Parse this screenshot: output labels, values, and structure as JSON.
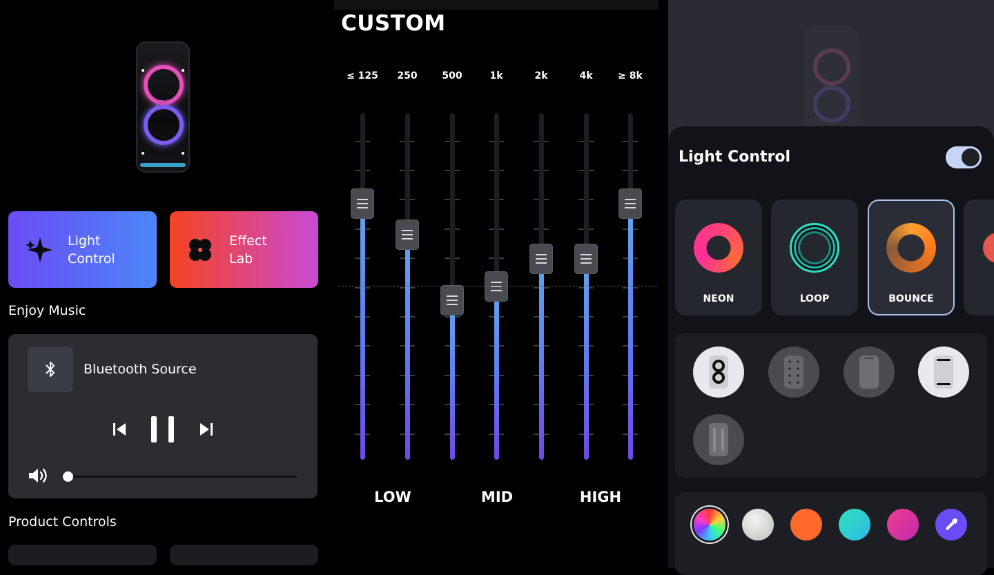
{
  "home": {
    "tiles": [
      {
        "label": "Light\nControl",
        "icon": "sparkle-icon",
        "gradient": [
          "#6a4cf5",
          "#4d86f7"
        ]
      },
      {
        "label": "Effect\nLab",
        "icon": "flower-icon",
        "gradient": [
          "#f5441f",
          "#c84ad6"
        ]
      }
    ],
    "enjoy_music": "Enjoy Music",
    "source_label": "Bluetooth Source",
    "source_icon": "bluetooth-icon",
    "volume_level": 0.03,
    "product_controls": "Product Controls"
  },
  "eq": {
    "title": "CUSTOM",
    "bands": [
      {
        "label": "≤ 125",
        "level": 0.74
      },
      {
        "label": "250",
        "level": 0.65
      },
      {
        "label": "500",
        "level": 0.46
      },
      {
        "label": "1k",
        "level": 0.5
      },
      {
        "label": "2k",
        "level": 0.58
      },
      {
        "label": "4k",
        "level": 0.58
      },
      {
        "label": "≥ 8k",
        "level": 0.74
      }
    ],
    "groups": [
      "LOW",
      "MID",
      "HIGH"
    ]
  },
  "light": {
    "title": "Light Control",
    "enabled": true,
    "effects": [
      {
        "label": "NEON",
        "selected": false
      },
      {
        "label": "LOOP",
        "selected": false
      },
      {
        "label": "BOUNCE",
        "selected": true
      }
    ],
    "patterns": [
      {
        "icon": "figure-eight-pattern-icon",
        "active": true
      },
      {
        "icon": "dots-pattern-icon",
        "active": false
      },
      {
        "icon": "full-panel-pattern-icon",
        "active": false
      },
      {
        "icon": "bars-pattern-icon",
        "active": true
      },
      {
        "icon": "side-lines-pattern-icon",
        "active": false
      }
    ],
    "colors": [
      {
        "name": "rainbow",
        "selected": true
      },
      {
        "name": "white",
        "value": "#d9d9d6",
        "selected": false
      },
      {
        "name": "orange",
        "value": "#ff6a2c",
        "selected": false
      },
      {
        "name": "teal",
        "value": "#26d6c8",
        "selected": false
      },
      {
        "name": "magenta",
        "value": "#d62c9e",
        "selected": false
      },
      {
        "name": "custom",
        "value": "#6a4cf5",
        "icon": "eyedropper-icon",
        "selected": false
      }
    ]
  }
}
